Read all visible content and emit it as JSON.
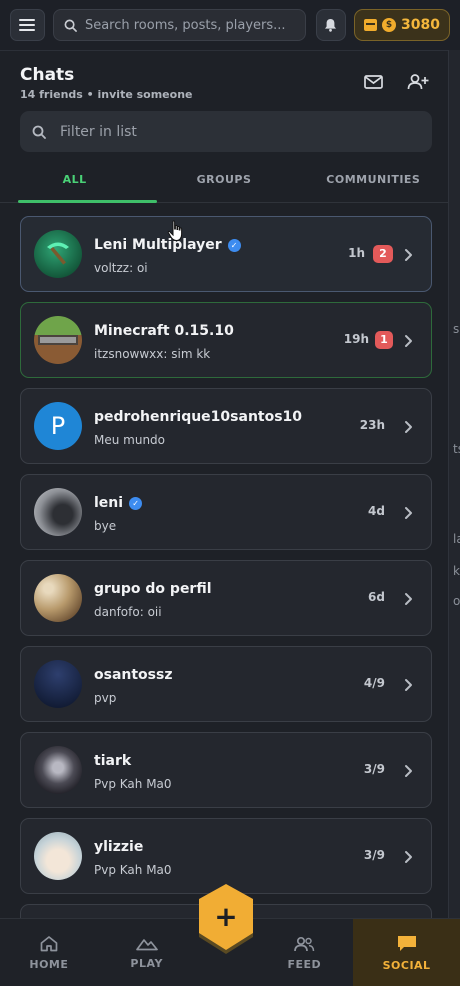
{
  "topbar": {
    "search_placeholder": "Search rooms, posts, players...",
    "coins": "3080",
    "icons": [
      "hamburger-menu-icon",
      "search-icon",
      "bell-icon",
      "gift-box-icon",
      "coin-icon"
    ]
  },
  "side_strip": [
    "s",
    "ts",
    "la",
    "k",
    "or"
  ],
  "panel": {
    "title": "Chats",
    "subtitle": "14 friends • invite someone",
    "filter_placeholder": "Filter in list",
    "tabs": [
      {
        "label": "ALL",
        "active": true
      },
      {
        "label": "GROUPS",
        "active": false
      },
      {
        "label": "COMMUNITIES",
        "active": false
      }
    ]
  },
  "chats": [
    {
      "name": "Leni Multiplayer",
      "verified": true,
      "preview": "voltzz: oi",
      "time": "1h",
      "unread": "2",
      "avatar": "emerald-pickaxe",
      "selected": true
    },
    {
      "name": "Minecraft 0.15.10",
      "verified": false,
      "preview": "itzsnowwxx: sim kk",
      "time": "19h",
      "unread": "1",
      "avatar": "minecraft-grass-block",
      "selected": false
    },
    {
      "name": "pedrohenrique10santos10",
      "verified": false,
      "preview": "Meu mundo",
      "time": "23h",
      "unread": "",
      "avatar": "letter-p",
      "letter": "P",
      "selected": false
    },
    {
      "name": "leni",
      "verified": true,
      "preview": "bye",
      "time": "4d",
      "unread": "",
      "avatar": "photo",
      "selected": false
    },
    {
      "name": "grupo do perfil",
      "verified": false,
      "preview": "danfofo: oii",
      "time": "6d",
      "unread": "",
      "avatar": "leopard-photo",
      "selected": false
    },
    {
      "name": "osantossz",
      "verified": false,
      "preview": "pvp",
      "time": "4/9",
      "unread": "",
      "avatar": "night-photo",
      "selected": false
    },
    {
      "name": "tiark",
      "verified": false,
      "preview": "Pvp Kah Ma0",
      "time": "3/9",
      "unread": "",
      "avatar": "anime-photo",
      "selected": false
    },
    {
      "name": "ylizzie",
      "verified": false,
      "preview": "Pvp Kah Ma0",
      "time": "3/9",
      "unread": "",
      "avatar": "anime-girl-photo",
      "selected": false
    }
  ],
  "fab": {
    "label": "+",
    "icon": "plus-icon"
  },
  "nav": [
    {
      "label": "HOME",
      "icon": "home-icon",
      "active": false
    },
    {
      "label": "PLAY",
      "icon": "mountain-icon",
      "active": false
    },
    {
      "label": "FEED",
      "icon": "people-icon",
      "active": false
    },
    {
      "label": "SOCIAL",
      "icon": "chat-icon",
      "active": true
    }
  ],
  "colors": {
    "accent_green": "#3fbf69",
    "accent_gold": "#f3b23a",
    "badge_red": "#e35a5a",
    "verified_blue": "#3d8cf0",
    "background": "#1e2127"
  }
}
